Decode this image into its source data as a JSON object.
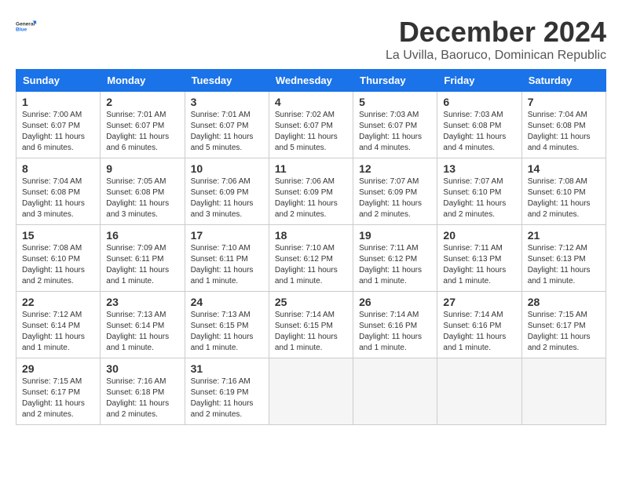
{
  "logo": {
    "line1": "General",
    "line2": "Blue"
  },
  "title": "December 2024",
  "subtitle": "La Uvilla, Baoruco, Dominican Republic",
  "days_of_week": [
    "Sunday",
    "Monday",
    "Tuesday",
    "Wednesday",
    "Thursday",
    "Friday",
    "Saturday"
  ],
  "weeks": [
    [
      {
        "day": 1,
        "info": "Sunrise: 7:00 AM\nSunset: 6:07 PM\nDaylight: 11 hours and 6 minutes."
      },
      {
        "day": 2,
        "info": "Sunrise: 7:01 AM\nSunset: 6:07 PM\nDaylight: 11 hours and 6 minutes."
      },
      {
        "day": 3,
        "info": "Sunrise: 7:01 AM\nSunset: 6:07 PM\nDaylight: 11 hours and 5 minutes."
      },
      {
        "day": 4,
        "info": "Sunrise: 7:02 AM\nSunset: 6:07 PM\nDaylight: 11 hours and 5 minutes."
      },
      {
        "day": 5,
        "info": "Sunrise: 7:03 AM\nSunset: 6:07 PM\nDaylight: 11 hours and 4 minutes."
      },
      {
        "day": 6,
        "info": "Sunrise: 7:03 AM\nSunset: 6:08 PM\nDaylight: 11 hours and 4 minutes."
      },
      {
        "day": 7,
        "info": "Sunrise: 7:04 AM\nSunset: 6:08 PM\nDaylight: 11 hours and 4 minutes."
      }
    ],
    [
      {
        "day": 8,
        "info": "Sunrise: 7:04 AM\nSunset: 6:08 PM\nDaylight: 11 hours and 3 minutes."
      },
      {
        "day": 9,
        "info": "Sunrise: 7:05 AM\nSunset: 6:08 PM\nDaylight: 11 hours and 3 minutes."
      },
      {
        "day": 10,
        "info": "Sunrise: 7:06 AM\nSunset: 6:09 PM\nDaylight: 11 hours and 3 minutes."
      },
      {
        "day": 11,
        "info": "Sunrise: 7:06 AM\nSunset: 6:09 PM\nDaylight: 11 hours and 2 minutes."
      },
      {
        "day": 12,
        "info": "Sunrise: 7:07 AM\nSunset: 6:09 PM\nDaylight: 11 hours and 2 minutes."
      },
      {
        "day": 13,
        "info": "Sunrise: 7:07 AM\nSunset: 6:10 PM\nDaylight: 11 hours and 2 minutes."
      },
      {
        "day": 14,
        "info": "Sunrise: 7:08 AM\nSunset: 6:10 PM\nDaylight: 11 hours and 2 minutes."
      }
    ],
    [
      {
        "day": 15,
        "info": "Sunrise: 7:08 AM\nSunset: 6:10 PM\nDaylight: 11 hours and 2 minutes."
      },
      {
        "day": 16,
        "info": "Sunrise: 7:09 AM\nSunset: 6:11 PM\nDaylight: 11 hours and 1 minute."
      },
      {
        "day": 17,
        "info": "Sunrise: 7:10 AM\nSunset: 6:11 PM\nDaylight: 11 hours and 1 minute."
      },
      {
        "day": 18,
        "info": "Sunrise: 7:10 AM\nSunset: 6:12 PM\nDaylight: 11 hours and 1 minute."
      },
      {
        "day": 19,
        "info": "Sunrise: 7:11 AM\nSunset: 6:12 PM\nDaylight: 11 hours and 1 minute."
      },
      {
        "day": 20,
        "info": "Sunrise: 7:11 AM\nSunset: 6:13 PM\nDaylight: 11 hours and 1 minute."
      },
      {
        "day": 21,
        "info": "Sunrise: 7:12 AM\nSunset: 6:13 PM\nDaylight: 11 hours and 1 minute."
      }
    ],
    [
      {
        "day": 22,
        "info": "Sunrise: 7:12 AM\nSunset: 6:14 PM\nDaylight: 11 hours and 1 minute."
      },
      {
        "day": 23,
        "info": "Sunrise: 7:13 AM\nSunset: 6:14 PM\nDaylight: 11 hours and 1 minute."
      },
      {
        "day": 24,
        "info": "Sunrise: 7:13 AM\nSunset: 6:15 PM\nDaylight: 11 hours and 1 minute."
      },
      {
        "day": 25,
        "info": "Sunrise: 7:14 AM\nSunset: 6:15 PM\nDaylight: 11 hours and 1 minute."
      },
      {
        "day": 26,
        "info": "Sunrise: 7:14 AM\nSunset: 6:16 PM\nDaylight: 11 hours and 1 minute."
      },
      {
        "day": 27,
        "info": "Sunrise: 7:14 AM\nSunset: 6:16 PM\nDaylight: 11 hours and 1 minute."
      },
      {
        "day": 28,
        "info": "Sunrise: 7:15 AM\nSunset: 6:17 PM\nDaylight: 11 hours and 2 minutes."
      }
    ],
    [
      {
        "day": 29,
        "info": "Sunrise: 7:15 AM\nSunset: 6:17 PM\nDaylight: 11 hours and 2 minutes."
      },
      {
        "day": 30,
        "info": "Sunrise: 7:16 AM\nSunset: 6:18 PM\nDaylight: 11 hours and 2 minutes."
      },
      {
        "day": 31,
        "info": "Sunrise: 7:16 AM\nSunset: 6:19 PM\nDaylight: 11 hours and 2 minutes."
      },
      null,
      null,
      null,
      null
    ]
  ]
}
